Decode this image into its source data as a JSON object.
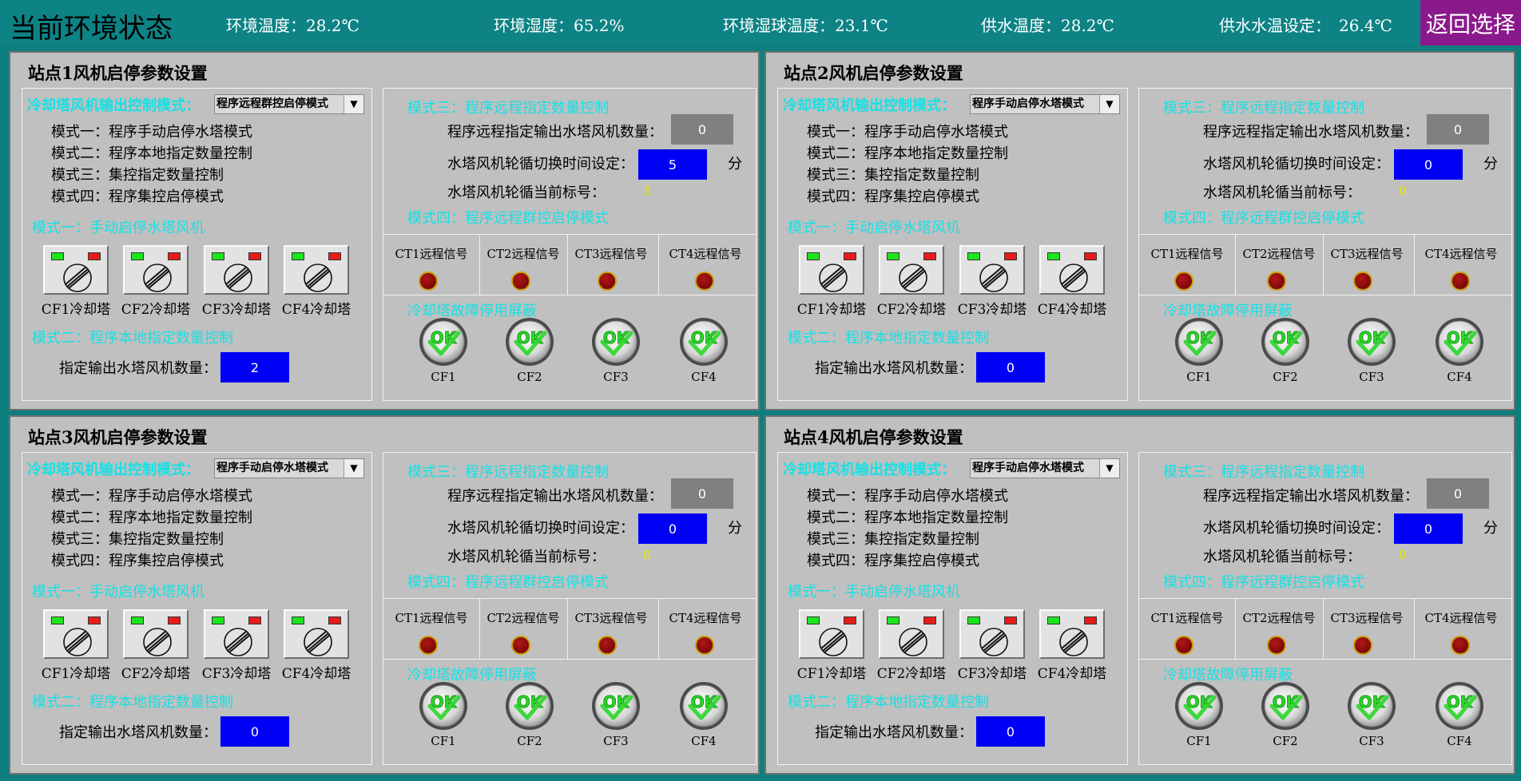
{
  "header": {
    "title": "当前环境状态",
    "env": [
      {
        "label": "环境温度：28.2℃"
      },
      {
        "label": "环境湿度：65.2%"
      },
      {
        "label": "环境湿球温度：23.1℃"
      },
      {
        "label": "供水温度：28.2℃"
      },
      {
        "label": "供水水温设定：　26.4℃"
      }
    ],
    "back_label": "返回选择"
  },
  "common": {
    "mode_select_label": "冷却塔风机输出控制模式：",
    "modes": [
      "模式一：程序手动启停水塔模式",
      "模式二：程序本地指定数量控制",
      "模式三：集控指定数量控制",
      "模式四：程序集控启停模式"
    ],
    "mode1_title": "模式一：手动启停水塔风机",
    "towers": [
      "CF1冷却塔",
      "CF2冷却塔",
      "CF3冷却塔",
      "CF4冷却塔"
    ],
    "mode2_title": "模式二：程序本地指定数量控制",
    "mode2_count_label": "指定输出水塔风机数量：",
    "mode3_title": "模式三：程序远程指定数量控制",
    "remote_count_label": "程序远程指定输出水塔风机数量：",
    "switch_time_label": "水塔风机轮循切换时间设定：",
    "unit": "分",
    "current_label": "水塔风机轮循当前标号：",
    "mode4_title": "模式四：程序远程群控启停模式",
    "signals": [
      "CT1远程信号",
      "CT2远程信号",
      "CT3远程信号",
      "CT4远程信号"
    ],
    "fault_title": "冷却塔故障停用屏蔽",
    "cf_labels": [
      "CF1",
      "CF2",
      "CF3",
      "CF4"
    ]
  },
  "stations": [
    {
      "title": "站点1风机启停参数设置",
      "mode": "程序远程群控启停模式",
      "local_count": "2",
      "remote_count": "0",
      "switch_time": "5",
      "current_index": "3"
    },
    {
      "title": "站点2风机启停参数设置",
      "mode": "程序手动启停水塔模式",
      "local_count": "0",
      "remote_count": "0",
      "switch_time": "0",
      "current_index": "0"
    },
    {
      "title": "站点3风机启停参数设置",
      "mode": "程序手动启停水塔模式",
      "local_count": "0",
      "remote_count": "0",
      "switch_time": "0",
      "current_index": "0"
    },
    {
      "title": "站点4风机启停参数设置",
      "mode": "程序手动启停水塔模式",
      "local_count": "0",
      "remote_count": "0",
      "switch_time": "0",
      "current_index": "0"
    }
  ],
  "colors": {
    "header_bg": "#0d8385",
    "back_bg": "#8a1a8c",
    "panel_bg": "#c0c0c0",
    "cyan_text": "#17e0e4",
    "input_blue": "#0000f4",
    "readonly_gray": "#808080",
    "indicator_red": "#8b0000",
    "ok_green": "#2bd62b"
  },
  "icons": {
    "switch": "rotary-switch-icon",
    "ok": "ok-check-icon",
    "signal": "signal-lamp-icon",
    "dropdown": "chevron-down-icon"
  }
}
